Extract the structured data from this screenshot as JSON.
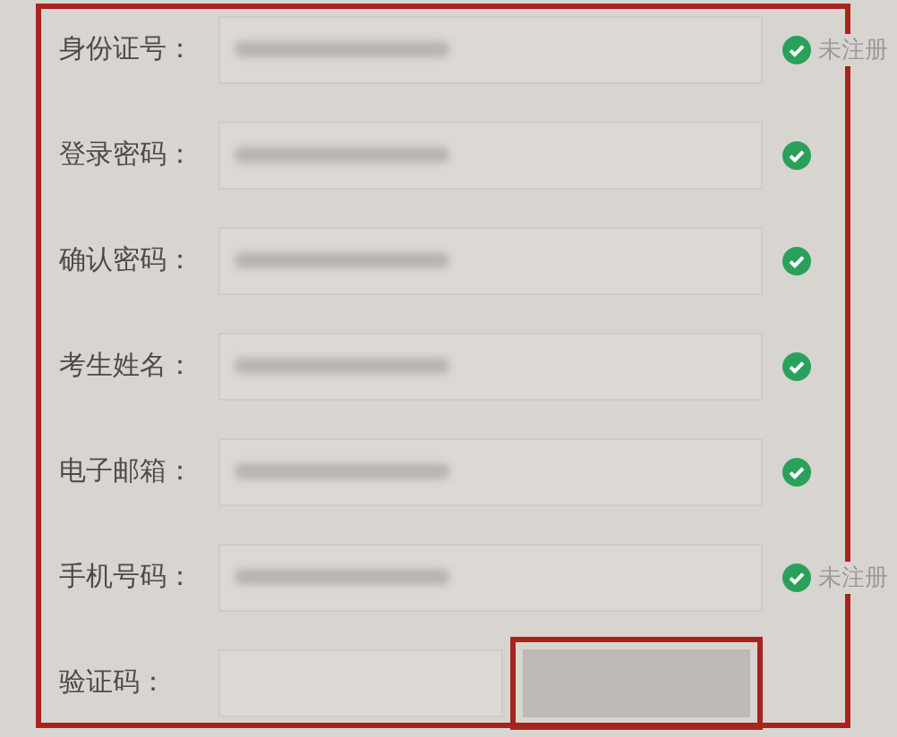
{
  "form": {
    "fields": [
      {
        "label": "身份证号：",
        "kind": "text",
        "blurred": true,
        "valid": true,
        "status": "未注册"
      },
      {
        "label": "登录密码：",
        "kind": "text",
        "blurred": true,
        "valid": true
      },
      {
        "label": "确认密码：",
        "kind": "text",
        "blurred": true,
        "valid": true
      },
      {
        "label": "考生姓名：",
        "kind": "text",
        "blurred": true,
        "valid": true
      },
      {
        "label": "电子邮箱：",
        "kind": "text",
        "blurred": true,
        "valid": true
      },
      {
        "label": "手机号码：",
        "kind": "text",
        "blurred": true,
        "valid": true,
        "status": "未注册"
      },
      {
        "label": "验证码：",
        "kind": "captcha",
        "button_highlighted": true
      }
    ]
  }
}
